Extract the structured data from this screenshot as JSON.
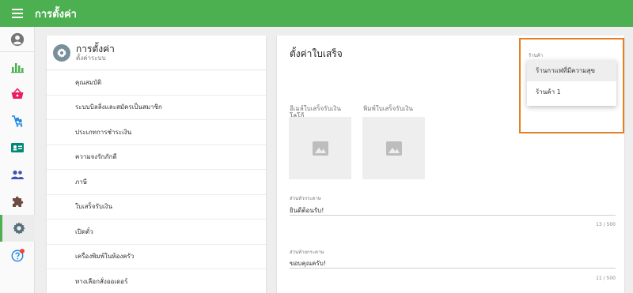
{
  "header": {
    "title": "การตั้งค่า"
  },
  "settings": {
    "title": "การตั้งค่า",
    "subtitle": "ตั้งค่าระบบ",
    "items": [
      "คุณสมบัติ",
      "ระบบบิลลิ่งและสมัครเป็นสมาชิก",
      "ประเภทการชำระเงิน",
      "ความจงรักภักดี",
      "ภาษี",
      "ใบเสร็จรับเงิน",
      "เปิดตั๋ว",
      "เครื่องพิมพ์ในห้องครัว",
      "ทางเลือกสั่งออเดอร์"
    ]
  },
  "receipt": {
    "title": "ตั้งค่าใบเสร็จ",
    "logo_label": "โลโก้",
    "email_logo_label": "อีเมล์ใบเสร็จรับเงิน",
    "print_logo_label": "พิมพ์ใบเสร็จรับเงิน",
    "header_label": "ส่วนหัวกระดาษ",
    "header_value": "ยินดีต้อนรับ!",
    "header_count": "13 / 500",
    "footer_label": "ส่วนท้ายกระดาษ",
    "footer_value": "ขอบคุณครับ!",
    "footer_count": "11 / 500"
  },
  "store_select": {
    "label": "ร้านค้า",
    "options": [
      "ร้านกาแฟที่มีความสุข",
      "ร้านค้า 1"
    ]
  },
  "colors": {
    "topbar": "#4caf50",
    "highlight": "#e67e22"
  },
  "icons": {
    "rail": [
      "account-circle-icon",
      "bar-chart-icon",
      "basket-icon",
      "inventory-cart-icon",
      "id-card-icon",
      "people-icon",
      "puzzle-icon",
      "gear-icon",
      "help-icon"
    ]
  }
}
